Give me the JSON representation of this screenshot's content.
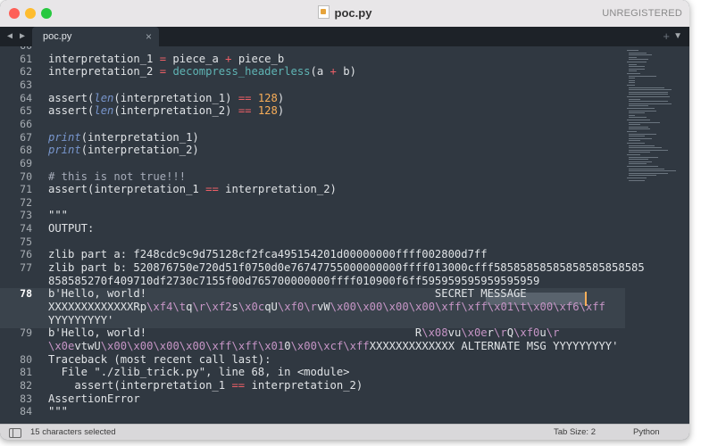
{
  "window": {
    "title": "poc.py",
    "registration": "UNREGISTERED"
  },
  "tabs": [
    {
      "label": "poc.py",
      "close": "×"
    }
  ],
  "tabbar": {
    "nav_arrows": "◀ ▶",
    "add_tab": "+",
    "menu": "▼"
  },
  "editor": {
    "current_line": "78",
    "selected_text": "SECRET MESSAGE",
    "line_numbers": [
      "60",
      "61",
      "62",
      "63",
      "64",
      "65",
      "66",
      "67",
      "68",
      "69",
      "70",
      "71",
      "72",
      "73",
      "74",
      "75",
      "76",
      "77",
      "",
      "78",
      "",
      "",
      "79",
      "",
      "80",
      "81",
      "82",
      "83",
      "84"
    ]
  },
  "code_lines": [
    {
      "ln": "60",
      "text": ""
    },
    {
      "ln": "61",
      "text": "interpretation_1 = piece_a + piece_b"
    },
    {
      "ln": "62",
      "text": "interpretation_2 = decompress_headerless(a + b)"
    },
    {
      "ln": "63",
      "text": ""
    },
    {
      "ln": "64",
      "text": "assert(len(interpretation_1) == 128)"
    },
    {
      "ln": "65",
      "text": "assert(len(interpretation_2) == 128)"
    },
    {
      "ln": "66",
      "text": ""
    },
    {
      "ln": "67",
      "text": "print(interpretation_1)"
    },
    {
      "ln": "68",
      "text": "print(interpretation_2)"
    },
    {
      "ln": "69",
      "text": ""
    },
    {
      "ln": "70",
      "text": "# this is not true!!!"
    },
    {
      "ln": "71",
      "text": "assert(interpretation_1 == interpretation_2)"
    },
    {
      "ln": "72",
      "text": ""
    },
    {
      "ln": "73",
      "text": "\"\"\""
    },
    {
      "ln": "74",
      "text": "OUTPUT:"
    },
    {
      "ln": "75",
      "text": ""
    },
    {
      "ln": "76",
      "text": "zlib part a: f248cdc9c9d75128cf2fca495154201d00000000ffff002800d7ff"
    },
    {
      "ln": "77",
      "text": "zlib part b: 520876750e720d51f0750d0e76747755000000000ffff013000cfff58585858585858585858585"
    },
    {
      "ln": "",
      "text": "858585270f409710df2730c7155f00d765700000000ffff010900f6ff595959595959595959"
    },
    {
      "ln": "78",
      "text": "b'Hello, world!                                            SECRET MESSAGE"
    },
    {
      "ln": "",
      "text": "XXXXXXXXXXXXXRp\\xf4\\tq\\r\\xf2s\\x0cqU\\xf0\\rvW\\x00\\x00\\x00\\x00\\xff\\xff\\x01\\t\\x00\\xf6\\xff"
    },
    {
      "ln": "",
      "text": "YYYYYYYYY'"
    },
    {
      "ln": "79",
      "text": "b'Hello, world!                                         R\\x08vu\\x0er\\rQ\\xf0u\\r"
    },
    {
      "ln": "",
      "text": "\\x0evtwU\\x00\\x00\\x00\\x00\\xff\\xff\\x010\\x00\\xcf\\xffXXXXXXXXXXXXX ALTERNATE MSG YYYYYYYYY'"
    },
    {
      "ln": "80",
      "text": "Traceback (most recent call last):"
    },
    {
      "ln": "81",
      "text": "  File \"./zlib_trick.py\", line 68, in <module>"
    },
    {
      "ln": "82",
      "text": "    assert(interpretation_1 == interpretation_2)"
    },
    {
      "ln": "83",
      "text": "AssertionError"
    },
    {
      "ln": "84",
      "text": "\"\"\""
    }
  ],
  "statusbar": {
    "selection": "15 characters selected",
    "tab_size": "Tab Size: 2",
    "syntax": "Python"
  },
  "colors": {
    "background": "#303841",
    "keyword": "#7896cd",
    "function": "#5fb4b4",
    "operator": "#ec5f66",
    "number": "#f9ae58",
    "escape": "#c695c6",
    "caret": "#f9ae58"
  }
}
